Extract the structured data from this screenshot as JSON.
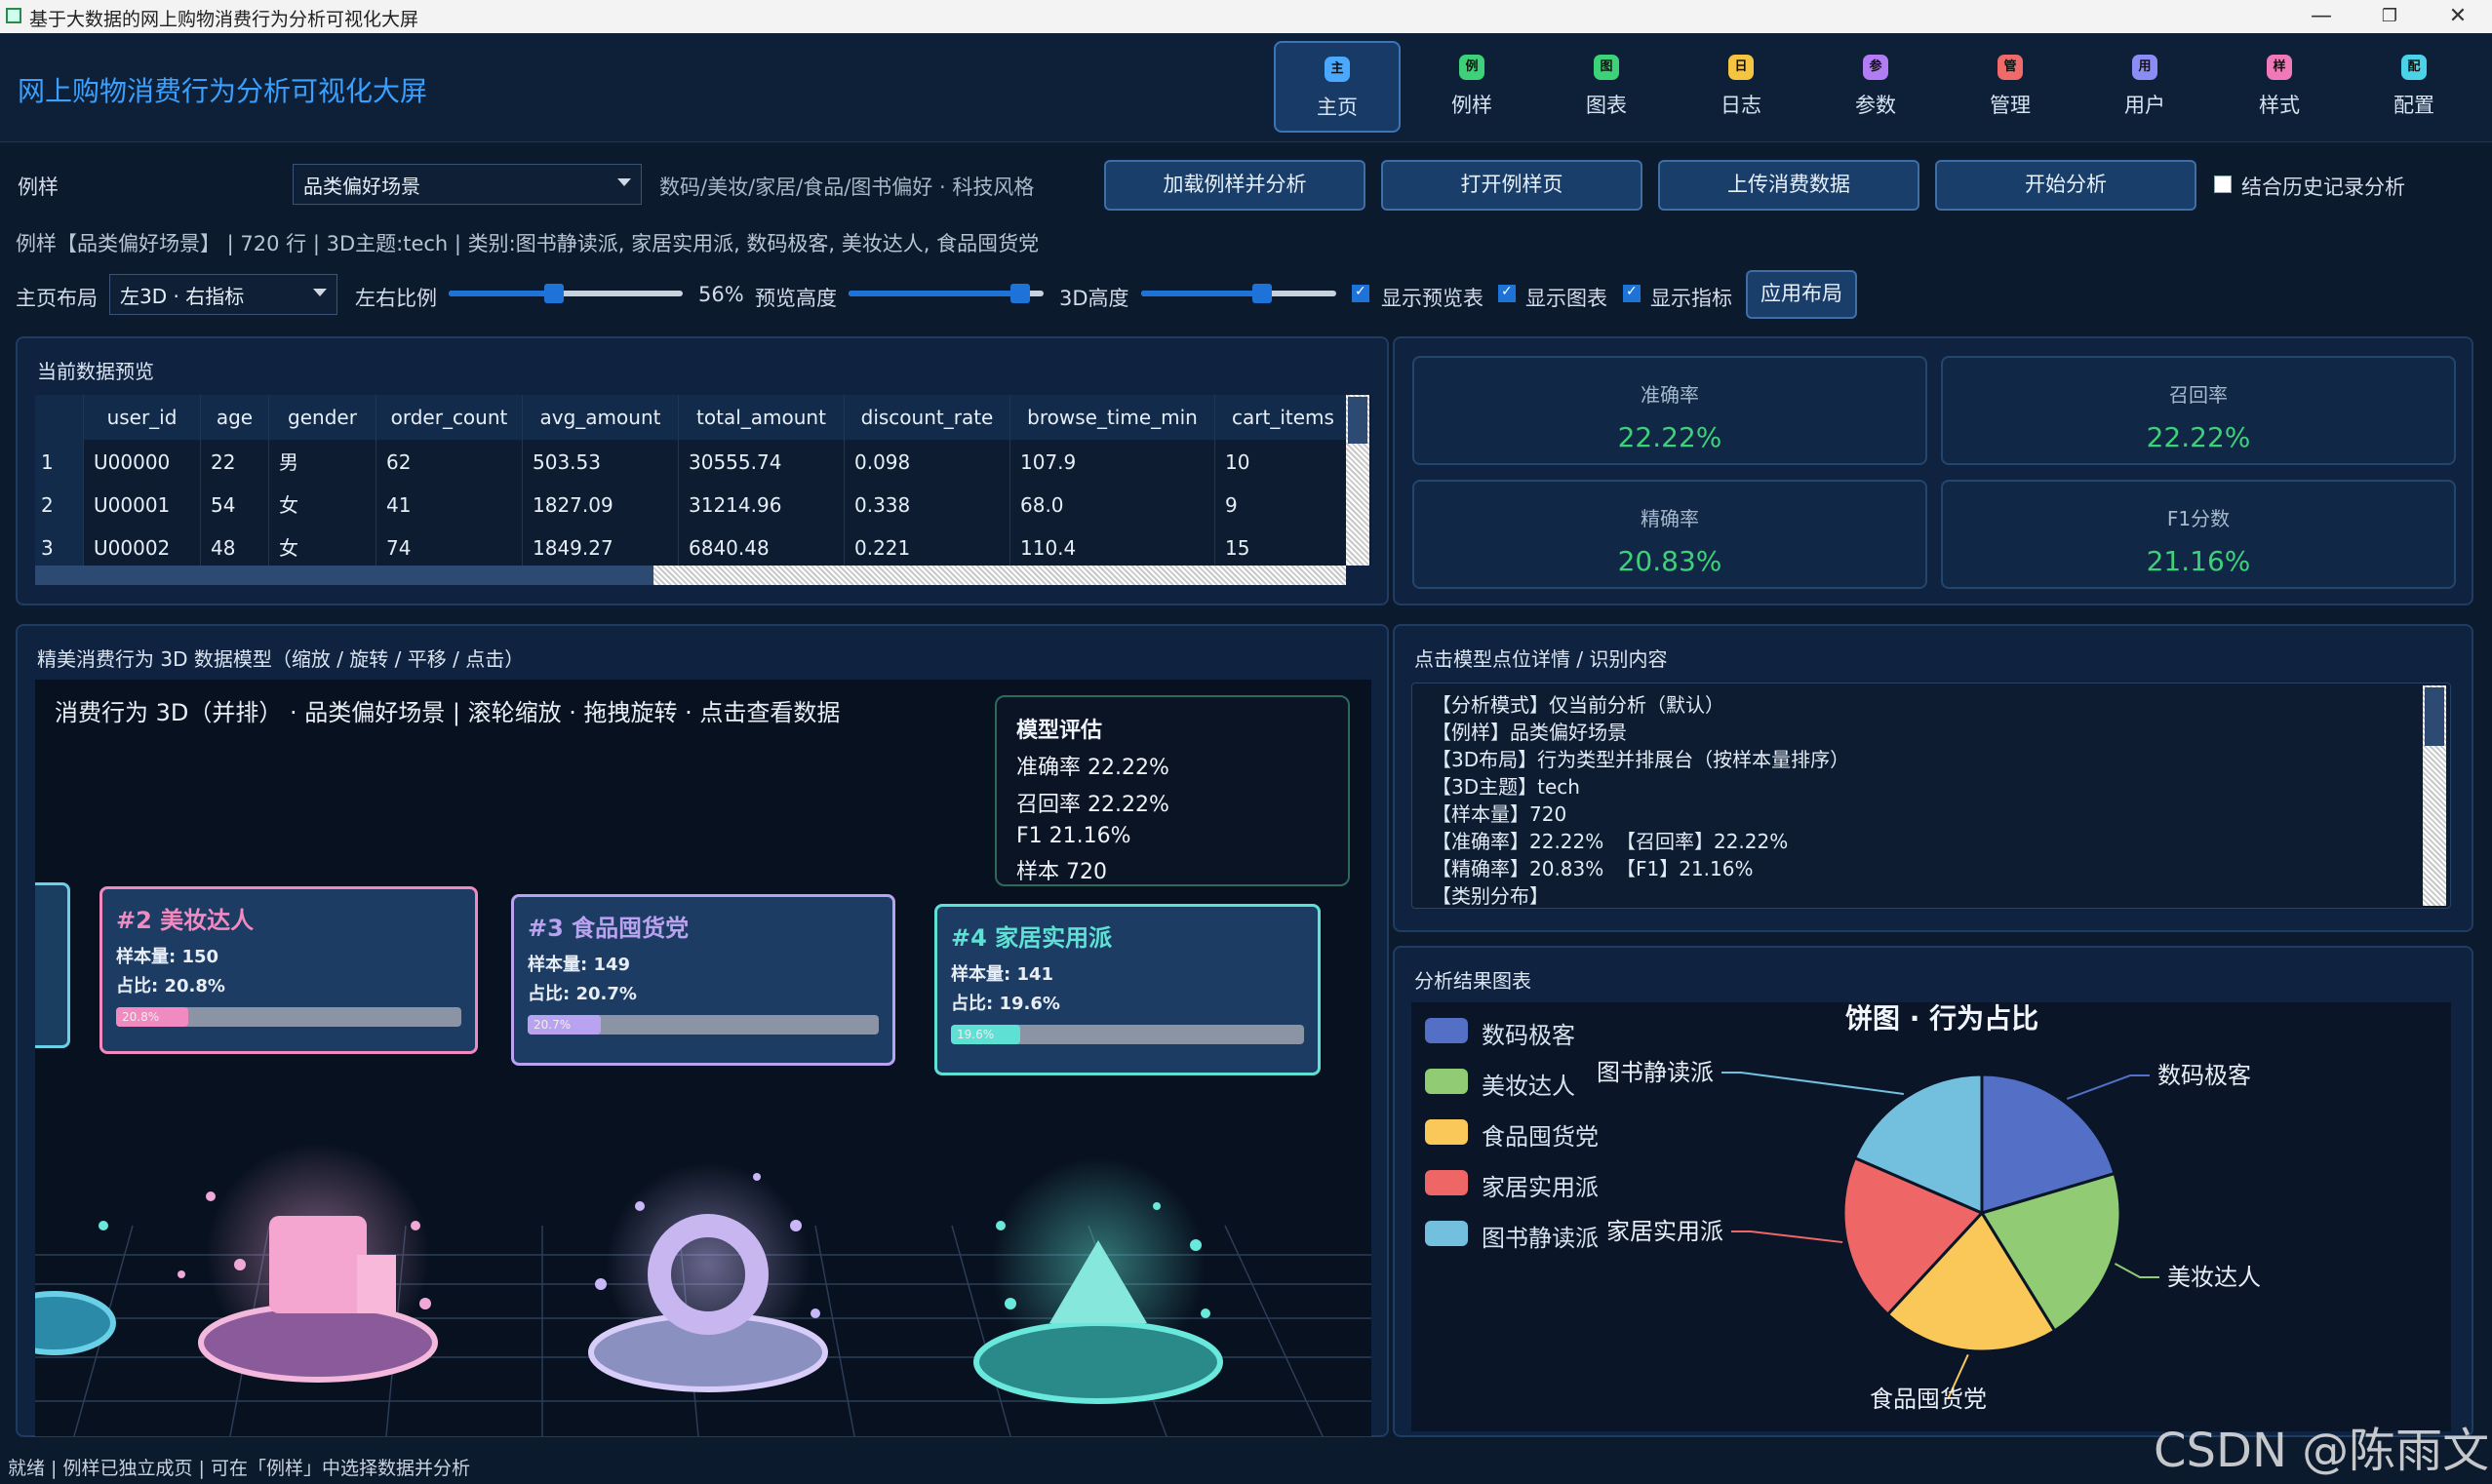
{
  "window": {
    "title": "基于大数据的网上购物消费行为分析可视化大屏",
    "min": "—",
    "max": "❐",
    "close": "✕"
  },
  "header": {
    "app_title": "网上购物消费行为分析可视化大屏",
    "nav": [
      {
        "icon": "主",
        "label": "主页",
        "color": "#4aa8ff"
      },
      {
        "icon": "例",
        "label": "例样",
        "color": "#3dd17a"
      },
      {
        "icon": "图",
        "label": "图表",
        "color": "#3dd17a"
      },
      {
        "icon": "日",
        "label": "日志",
        "color": "#f5c542"
      },
      {
        "icon": "参",
        "label": "参数",
        "color": "#b27cf5"
      },
      {
        "icon": "管",
        "label": "管理",
        "color": "#f06a6a"
      },
      {
        "icon": "用",
        "label": "用户",
        "color": "#8c8cf5"
      },
      {
        "icon": "样",
        "label": "样式",
        "color": "#f07ab8"
      },
      {
        "icon": "配",
        "label": "配置",
        "color": "#4ad2e8"
      }
    ]
  },
  "toolbar": {
    "sample_label": "例样",
    "sample_value": "品类偏好场景",
    "sample_hint": "数码/美妆/家居/食品/图书偏好 · 科技风格",
    "btn_load": "加载例样并分析",
    "btn_open": "打开例样页",
    "btn_upload": "上传消费数据",
    "btn_start": "开始分析",
    "history_label": "结合历史记录分析",
    "info_line": "例样【品类偏好场景】 | 720 行 | 3D主题:tech | 类别:图书静读派, 家居实用派, 数码极客, 美妆达人, 食品囤货党"
  },
  "layout": {
    "label": "主页布局",
    "value": "左3D · 右指标",
    "ratio_label": "左右比例",
    "ratio_value": "56%",
    "ratio_level": 0.45,
    "preview_label": "预览高度",
    "preview_level": 0.88,
    "height3d_label": "3D高度",
    "height3d_level": 0.62,
    "show_preview": "显示预览表",
    "show_chart": "显示图表",
    "show_metrics": "显示指标",
    "apply": "应用布局"
  },
  "preview": {
    "title": "当前数据预览",
    "columns": [
      "",
      "user_id",
      "age",
      "gender",
      "order_count",
      "avg_amount",
      "total_amount",
      "discount_rate",
      "browse_time_min",
      "cart_items"
    ],
    "rows": [
      [
        "1",
        "U00000",
        "22",
        "男",
        "62",
        "503.53",
        "30555.74",
        "0.098",
        "107.9",
        "10"
      ],
      [
        "2",
        "U00001",
        "54",
        "女",
        "41",
        "1827.09",
        "31214.96",
        "0.338",
        "68.0",
        "9"
      ],
      [
        "3",
        "U00002",
        "48",
        "女",
        "74",
        "1849.27",
        "6840.48",
        "0.221",
        "110.4",
        "15"
      ]
    ]
  },
  "metrics": [
    {
      "label": "准确率",
      "value": "22.22%"
    },
    {
      "label": "召回率",
      "value": "22.22%"
    },
    {
      "label": "精确率",
      "value": "20.83%"
    },
    {
      "label": "F1分数",
      "value": "21.16%"
    }
  ],
  "model3d": {
    "panel_title": "精美消费行为 3D 数据模型（缩放 / 旋转 / 平移 / 点击）",
    "scene_caption": "消费行为 3D（并排） · 品类偏好场景 | 滚轮缩放 · 拖拽旋转 · 点击查看数据",
    "eval": {
      "title": "模型评估",
      "lines": [
        "准确率 22.22%",
        "召回率 22.22%",
        "F1 21.16%",
        "样本 720"
      ]
    },
    "cards": [
      {
        "title": "#2  美妆达人",
        "count": "样本量: 150",
        "share": "占比: 20.8%",
        "bar": "20.8%",
        "level": 0.208,
        "color": "#f08ac0"
      },
      {
        "title": "#3  食品囤货党",
        "count": "样本量: 149",
        "share": "占比: 20.7%",
        "bar": "20.7%",
        "level": 0.207,
        "color": "#b9a2f0"
      },
      {
        "title": "#4  家居实用派",
        "count": "样本量: 141",
        "share": "占比: 19.6%",
        "bar": "19.6%",
        "level": 0.196,
        "color": "#5fe0d4"
      }
    ]
  },
  "detail": {
    "title": "点击模型点位详情 / 识别内容",
    "lines": [
      "【分析模式】仅当前分析（默认）",
      "【例样】品类偏好场景",
      "【3D布局】行为类型并排展台（按样本量排序）",
      "【3D主题】tech",
      "【样本量】720",
      "【准确率】22.22%  【召回率】22.22%",
      "【精确率】20.83%  【F1】21.16%",
      "【类别分布】"
    ]
  },
  "chart_panel": {
    "title": "分析结果图表"
  },
  "chart_data": {
    "type": "pie",
    "title": "饼图 · 行为占比",
    "categories": [
      "数码极客",
      "美妆达人",
      "食品囤货党",
      "家居实用派",
      "图书静读派"
    ],
    "values": [
      20.4,
      20.8,
      20.7,
      19.6,
      18.5
    ],
    "colors": [
      "#5470c6",
      "#91cc75",
      "#fac858",
      "#ee6666",
      "#73c0de"
    ],
    "legend": "left"
  },
  "status": "就绪 | 例样已独立成页 | 可在「例样」中选择数据并分析",
  "watermark": "CSDN @陈雨文"
}
